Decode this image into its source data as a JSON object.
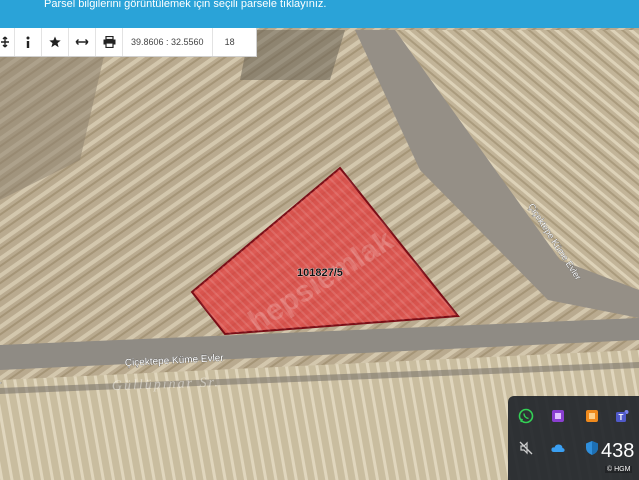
{
  "banner": {
    "text": "Parsel bilgilerini görüntülemek için seçili parsele tıklayınız."
  },
  "toolbar": {
    "buttons": [
      {
        "icon": "move-icon"
      },
      {
        "icon": "info-icon"
      },
      {
        "icon": "star-icon"
      },
      {
        "icon": "measure-icon"
      },
      {
        "icon": "print-icon"
      }
    ],
    "coordinates": "39.8606 : 32.5560",
    "zoom": "18"
  },
  "map": {
    "parcel_label": "101827/5",
    "road_label_lower": "Çiçektepe Küme Evler",
    "road_label_right": "Çiçektepe Küme Evler",
    "watermark": "hepsiemlak",
    "place_label": "Güllüpınar Sr.",
    "attribution": "© HGM",
    "parcel_fill": "#e03c3c",
    "parcel_stroke": "#7a0d16"
  },
  "tray": {
    "icons": [
      "whatsapp-icon",
      "notes-icon",
      "app-orange-icon",
      "teams-icon",
      "no-sound-icon",
      "cloud-icon",
      "security-icon"
    ],
    "count": "438"
  }
}
